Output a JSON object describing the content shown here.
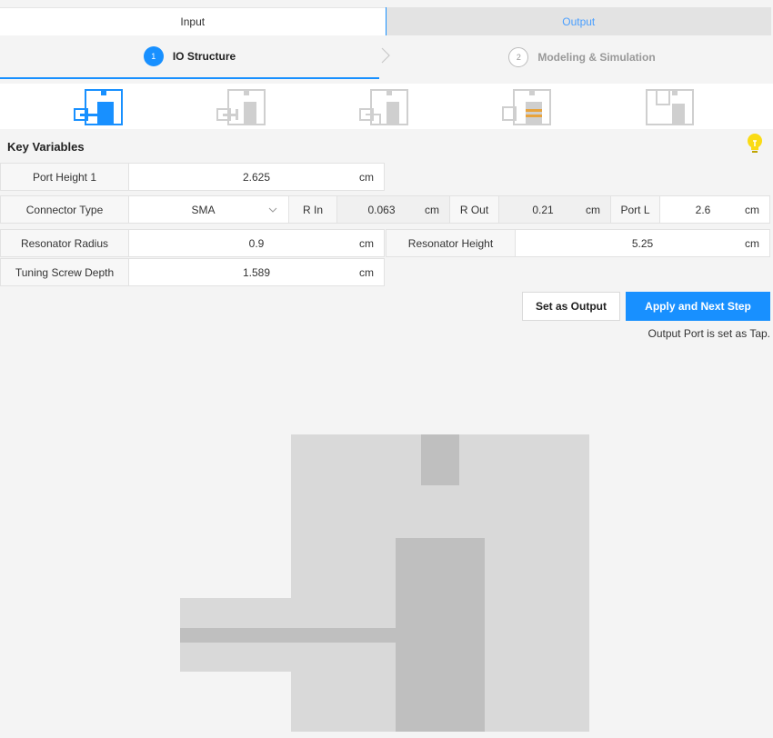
{
  "tabs": {
    "input": "Input",
    "output": "Output"
  },
  "steps": [
    {
      "num": "1",
      "label": "IO Structure"
    },
    {
      "num": "2",
      "label": "Modeling & Simulation"
    }
  ],
  "structure_icons": [
    "tap-structure-icon",
    "probe-structure-icon",
    "loop-structure-icon",
    "disc-structure-icon",
    "step-structure-icon"
  ],
  "key_variables": {
    "title": "Key Variables",
    "port_height_1": {
      "label": "Port Height 1",
      "value": "2.625",
      "unit": "cm"
    },
    "connector_type": {
      "label": "Connector Type",
      "value": "SMA"
    },
    "r_in": {
      "label": "R In",
      "value": "0.063",
      "unit": "cm"
    },
    "r_out": {
      "label": "R Out",
      "value": "0.21",
      "unit": "cm"
    },
    "port_l": {
      "label": "Port L",
      "value": "2.6",
      "unit": "cm"
    },
    "resonator_radius": {
      "label": "Resonator Radius",
      "value": "0.9",
      "unit": "cm"
    },
    "resonator_height": {
      "label": "Resonator Height",
      "value": "5.25",
      "unit": "cm"
    },
    "tuning_screw_depth": {
      "label": "Tuning Screw Depth",
      "value": "1.589",
      "unit": "cm"
    }
  },
  "buttons": {
    "set_output": "Set as Output",
    "apply_next": "Apply and Next Step"
  },
  "note": "Output Port is set as Tap.",
  "colors": {
    "accent": "#1890ff",
    "bulb": "#fadb14",
    "disc": "#e8a33c"
  }
}
